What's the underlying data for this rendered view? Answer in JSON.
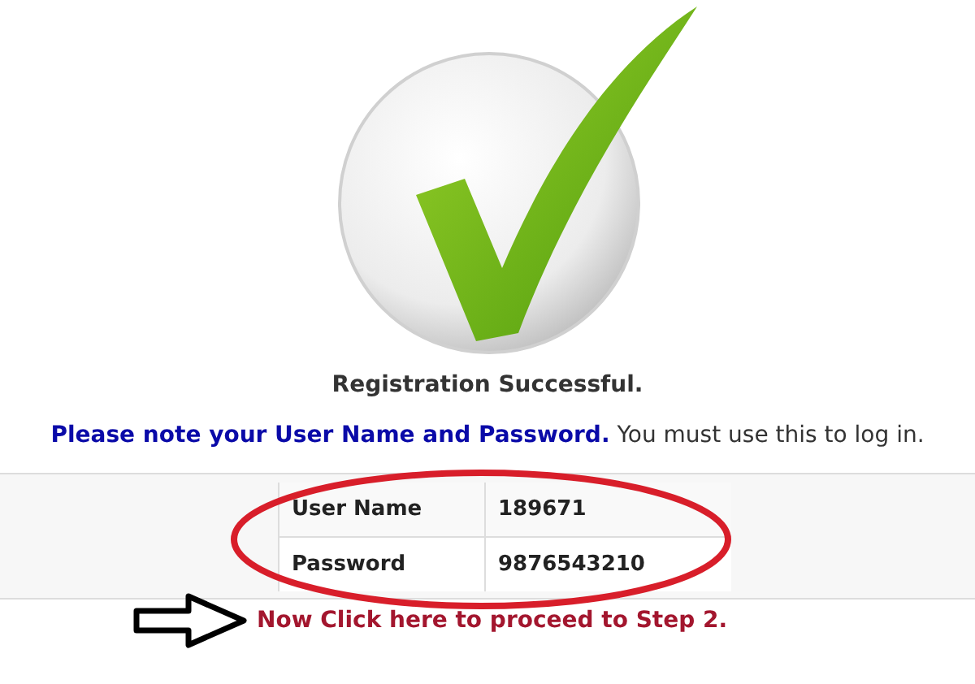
{
  "heading": "Registration Successful.",
  "note": "**Please note your User Name and Password.** You must use this to log in.",
  "credentials": [
    {
      "label": "User Name",
      "value": "189671"
    },
    {
      "label": "Password",
      "value": "9876543210"
    }
  ],
  "next_link": "Now Click here to proceed to Step 2."
}
